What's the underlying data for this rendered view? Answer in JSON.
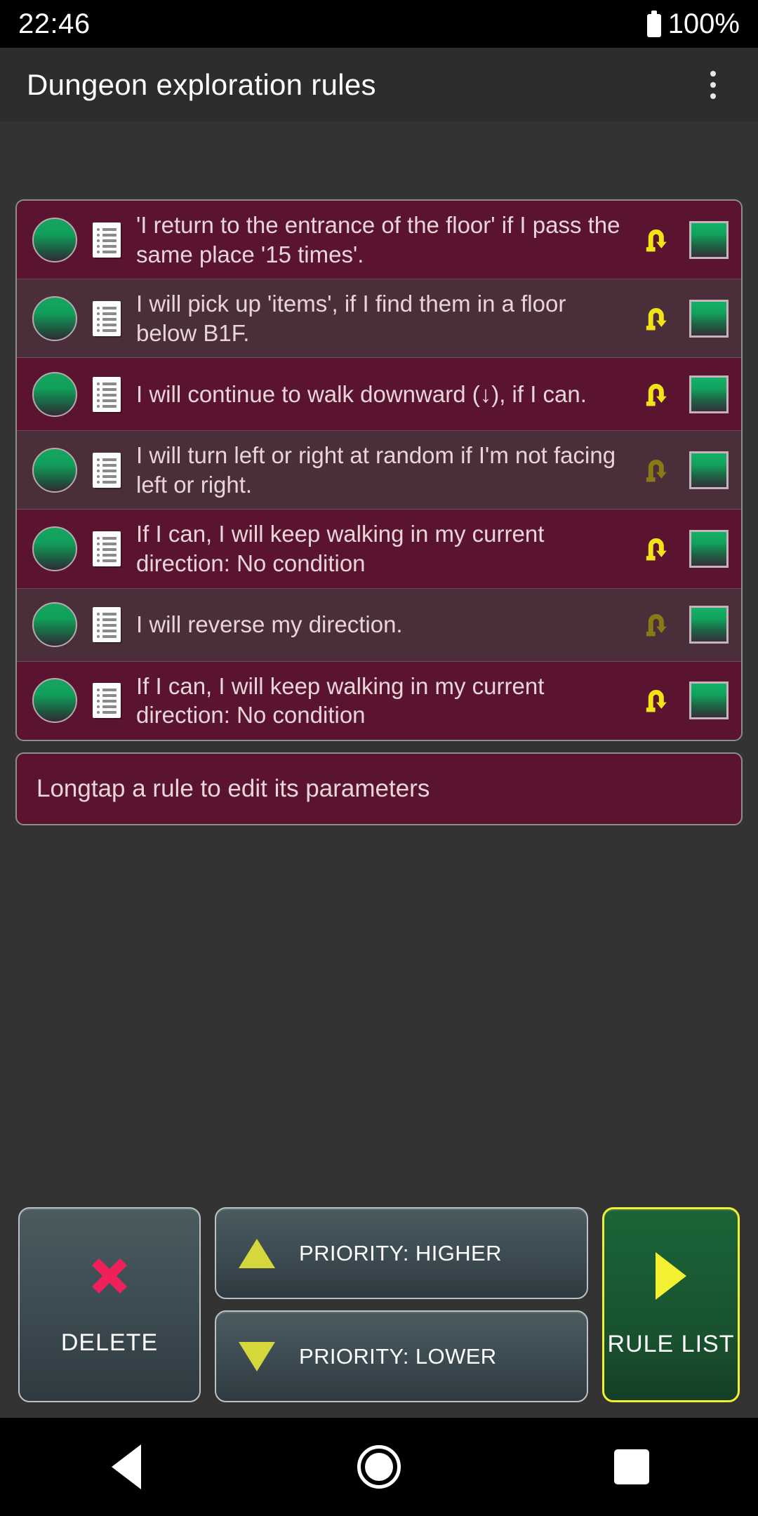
{
  "status_bar": {
    "time": "22:46",
    "battery_text": "100%",
    "battery_icon": "battery-full-icon"
  },
  "app_bar": {
    "title": "Dungeon exploration rules",
    "overflow_icon": "overflow-menu-icon"
  },
  "rules": [
    {
      "text": "'I return to the entrance of the floor' if I pass the same place '15 times'.",
      "enabled_led": true,
      "loop_active": true
    },
    {
      "text": "I will pick up 'items', if I find them in a floor below B1F.",
      "enabled_led": true,
      "loop_active": true
    },
    {
      "text": "I will continue to walk downward (↓), if I can.",
      "enabled_led": true,
      "loop_active": true
    },
    {
      "text": "I will turn left or right at random if I'm not facing left or right.",
      "enabled_led": true,
      "loop_active": false
    },
    {
      "text": "If I can, I will keep walking in my current direction: No condition",
      "enabled_led": true,
      "loop_active": true
    },
    {
      "text": "I will reverse my direction.",
      "enabled_led": true,
      "loop_active": false
    },
    {
      "text": "If I can, I will keep walking in my current direction: No condition",
      "enabled_led": true,
      "loop_active": true
    }
  ],
  "hint": {
    "text": "Longtap a rule to edit its parameters"
  },
  "buttons": {
    "delete": {
      "label": "DELETE",
      "icon": "close-x-icon"
    },
    "priority_higher": {
      "label": "PRIORITY: HIGHER",
      "icon": "triangle-up-icon"
    },
    "priority_lower": {
      "label": "PRIORITY: LOWER",
      "icon": "triangle-down-icon"
    },
    "rule_list": {
      "label": "RULE LIST",
      "icon": "play-arrow-icon"
    }
  },
  "nav_bar": {
    "back": "back-triangle-icon",
    "home": "home-circle-icon",
    "recents": "recents-square-icon"
  },
  "colors": {
    "card_row_dark": "#5b1430",
    "card_row_light": "#4a2f3a",
    "accent_yellow": "#f2f030",
    "led_green": "#14b167",
    "delete_x_red": "#f0205a",
    "app_bar": "#2d2d2d",
    "page_bg": "#333333"
  }
}
